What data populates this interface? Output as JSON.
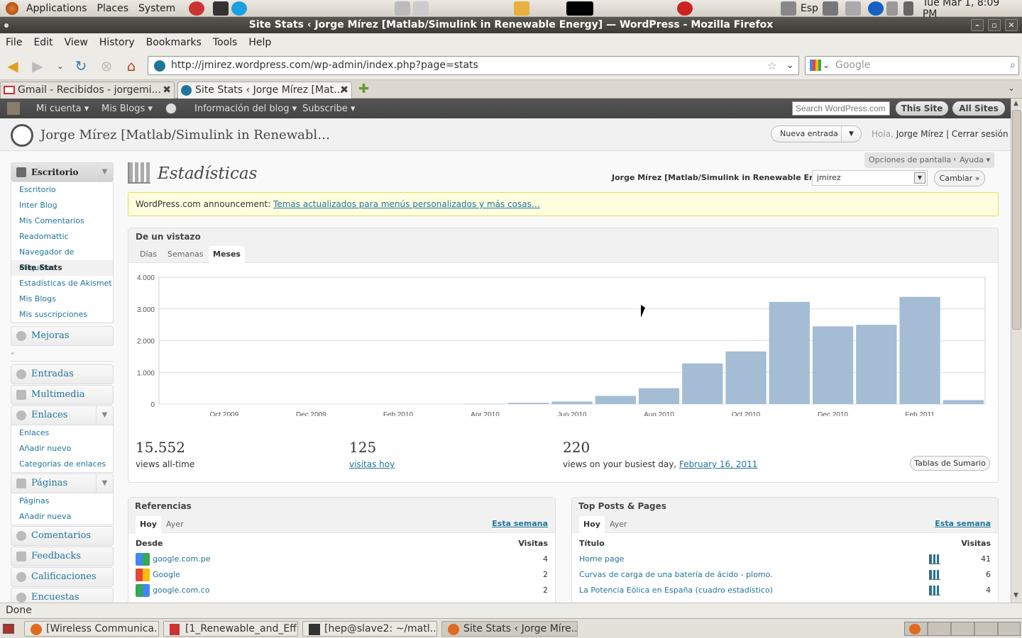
{
  "top_panel": {
    "applications": "Applications",
    "places": "Places",
    "system": "System",
    "keyboard": "Esp",
    "clock": "Tue Mar  1,  8:09 PM"
  },
  "window": {
    "title": "Site Stats ‹ Jorge Mírez [Matlab/Simulink in Renewable Energy] — WordPress - Mozilla Firefox"
  },
  "menubar": [
    "File",
    "Edit",
    "View",
    "History",
    "Bookmarks",
    "Tools",
    "Help"
  ],
  "navigation": {
    "url": "http://jmirez.wordpress.com/wp-admin/index.php?page=stats",
    "search_placeholder": "Google"
  },
  "tabs": [
    {
      "label": "Gmail - Recibidos - jorgemi..."
    },
    {
      "label": "Site Stats ‹ Jorge Mírez [Mat..."
    }
  ],
  "wp_bar": {
    "mi_cuenta": "Mi cuenta ▾",
    "mis_blogs": "Mis Blogs ▾",
    "info_blog": "Información del blog ▾",
    "subscribe": "Subscribe ▾",
    "search_placeholder": "Search WordPress.com",
    "this_site": "This Site",
    "all_sites": "All Sites"
  },
  "wp_header": {
    "blog_title": "Jorge Mírez [Matlab/Simulink in Renewabl…",
    "new_post": "Nueva entrada",
    "greeting": "Hola,",
    "user": "Jorge Mírez",
    "separator": "|",
    "logout": "Cerrar sesión"
  },
  "sidebar": {
    "escritorio": "Escritorio",
    "dashboard_items": [
      "Escritorio",
      "Inter Blog",
      "Mis Comentarios",
      "Readomattic",
      "Navegador de etiquetas",
      "Site Stats",
      "Estadísticas de Akismet",
      "Mis Blogs",
      "Mis suscripciones"
    ],
    "mejoras": "Mejoras",
    "entradas": "Entradas",
    "multimedia": "Multimedia",
    "enlaces": "Enlaces",
    "enlaces_items": [
      "Enlaces",
      "Añadir nuevo",
      "Categorías de enlaces"
    ],
    "paginas": "Páginas",
    "paginas_items": [
      "Páginas",
      "Añadir nueva"
    ],
    "comentarios": "Comentarios",
    "feedbacks": "Feedbacks",
    "calificaciones": "Calificaciones",
    "encuestas": "Encuestas"
  },
  "content": {
    "screen_options": "Opciones de pantalla ▾",
    "help": "Ayuda ▾",
    "page_title": "Estadísticas",
    "blog_label": "Jorge Mírez [Matlab/Simulink in Renewable Energy]",
    "blog_select": "jmirez",
    "change_button": "Cambiar »",
    "announcement_prefix": "WordPress.com announcement:",
    "announcement_link": "Temas actualizados para menús personalizados y más cosas…"
  },
  "glance": {
    "title": "De un vistazo",
    "tabs": [
      "Días",
      "Semanas",
      "Meses"
    ],
    "stats": [
      {
        "value": "15.552",
        "label": "views all-time"
      },
      {
        "value": "125",
        "label": "visitas hoy"
      },
      {
        "value": "220",
        "label": "views on your busiest day,",
        "link": "February 16, 2011"
      }
    ],
    "summary_button": "Tablas de Sumario"
  },
  "chart_data": {
    "type": "bar",
    "color": "#a4bcd4",
    "categories": [
      "Sep 2009",
      "Oct 2009",
      "Nov 2009",
      "Dec 2009",
      "Jan 2010",
      "Feb 2010",
      "Mar 2010",
      "Apr 2010",
      "May 2010",
      "Jun 2010",
      "Jul 2010",
      "Aug 2010",
      "Sep 2010",
      "Oct 2010",
      "Nov 2010",
      "Dec 2010",
      "Jan 2011",
      "Feb 2011",
      "Mar 2011"
    ],
    "x_tick_labels": [
      "Oct 2009",
      "Dec 2009",
      "Feb 2010",
      "Apr 2010",
      "Jun 2010",
      "Aug 2010",
      "Oct 2010",
      "Dec 2010",
      "Feb 2011"
    ],
    "values": [
      0,
      0,
      0,
      0,
      0,
      0,
      0,
      10,
      40,
      80,
      260,
      500,
      1280,
      1660,
      3220,
      2450,
      2500,
      3380,
      125
    ],
    "y_tick_labels": [
      "0",
      "1.000",
      "2.000",
      "3.000",
      "4.000"
    ],
    "ylim": [
      0,
      4000
    ]
  },
  "referrers": {
    "title": "Referencias",
    "tabs": [
      "Hoy",
      "Ayer"
    ],
    "period_link": "Esta semana",
    "col_from": "Desde",
    "col_visits": "Visitas",
    "rows": [
      {
        "name": "google.com.pe",
        "visits": "4"
      },
      {
        "name": "Google",
        "visits": "2"
      },
      {
        "name": "google.com.co",
        "visits": "2"
      }
    ]
  },
  "top_posts": {
    "title": "Top Posts & Pages",
    "tabs": [
      "Hoy",
      "Ayer"
    ],
    "period_link": "Esta semana",
    "col_title": "Título",
    "col_visits": "Visitas",
    "rows": [
      {
        "name": "Home page",
        "visits": "41"
      },
      {
        "name": "Curvas de carga de una batería de ácido - plomo.",
        "visits": "6"
      },
      {
        "name": "La Potencia Eólica en España (cuadro estadístico)",
        "visits": "4"
      }
    ]
  },
  "statusbar": "Done",
  "taskbar": [
    "[Wireless Communica...",
    "[1_Renewable_and_Eff...",
    "[hep@slave2: ~/matl...",
    "Site Stats ‹ Jorge Míre..."
  ]
}
